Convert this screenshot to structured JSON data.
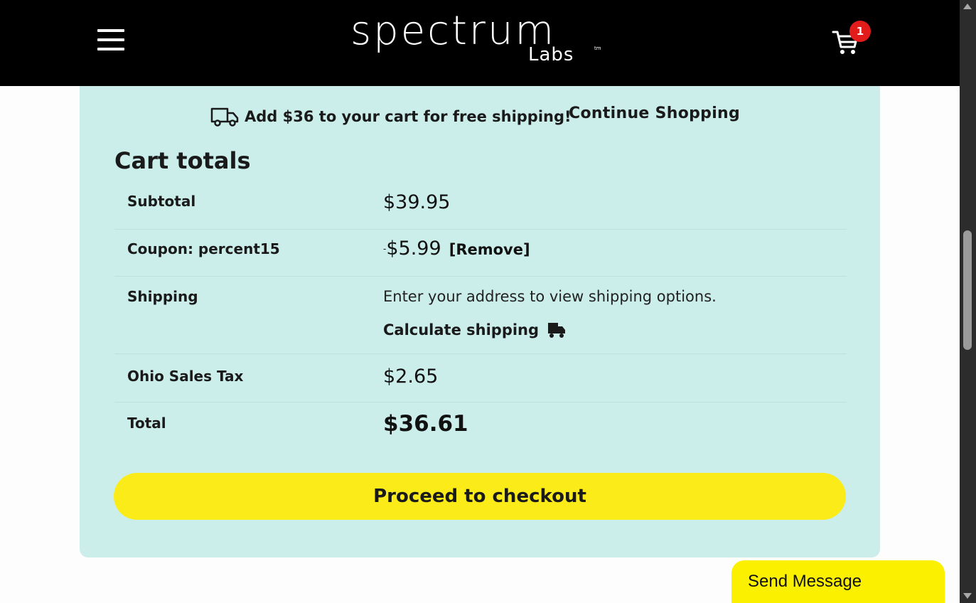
{
  "header": {
    "logo_main": "spectrum",
    "logo_sub": "Labs",
    "logo_tm": "tm",
    "cart_count": "1",
    "colors": {
      "background": "#000000",
      "badge": "#e21b1b"
    }
  },
  "notice": {
    "free_shipping_text": "Add $36 to your cart for free shipping!",
    "continue_label": "Continue Shopping",
    "icon": "truck-icon"
  },
  "cart_totals": {
    "title": "Cart totals",
    "subtotal_label": "Subtotal",
    "subtotal_value": "$39.95",
    "coupon_label": "Coupon: percent15",
    "coupon_minus": "-",
    "coupon_value": "$5.99",
    "remove_label": "[Remove]",
    "shipping_label": "Shipping",
    "shipping_message": "Enter your address to view shipping options.",
    "calculate_label": "Calculate shipping",
    "tax_label": "Ohio Sales Tax",
    "tax_value": "$2.65",
    "total_label": "Total",
    "total_value": "$36.61",
    "checkout_label": "Proceed to checkout",
    "colors": {
      "panel": "#cbeeeb",
      "checkout_button": "#fbec19"
    }
  },
  "chat": {
    "send_label": "Send Message",
    "color": "#fbf000"
  }
}
